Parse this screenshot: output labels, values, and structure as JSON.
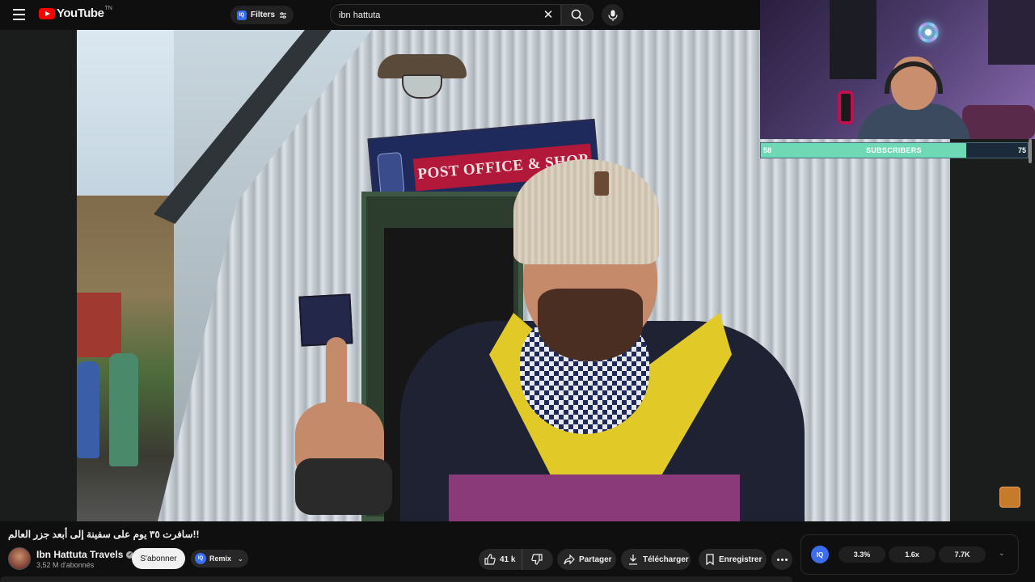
{
  "header": {
    "logo_text": "YouTube",
    "logo_region": "TN",
    "filters_label": "Filters",
    "filters_badge": "IQ",
    "search_value": "ibn hattuta"
  },
  "video_overlay": {
    "sign_text": "POST OFFICE & SHOP"
  },
  "subscriber_goal": {
    "start": "58",
    "label": "SUBSCRIBERS",
    "end": "75",
    "progress_fraction": 0.77,
    "fill_color": "#6fd8b4"
  },
  "video": {
    "title": "!!سافرت ٣٥ يوم على سفينة إلى أبعد جزر العالم",
    "channel_name": "Ibn Hattuta Travels",
    "subscribers": "3,52 M d'abonnés",
    "subscribe_label": "S'abonner",
    "remix_label": "Remix",
    "remix_badge": "IQ"
  },
  "actions": {
    "like_count": "41 k",
    "share_label": "Partager",
    "download_label": "Télécharger",
    "save_label": "Enregistrer"
  },
  "stats": {
    "badge": "IQ",
    "values": [
      "3.3%",
      "1.6x",
      "7.7K"
    ]
  },
  "colors": {
    "accent": "#ff0000",
    "iq_blue": "#3b6df0",
    "background": "#0f0f0f"
  },
  "icons": [
    "menu-icon",
    "youtube-logo-icon",
    "filter-icon",
    "close-icon",
    "search-icon",
    "mic-icon",
    "verified-icon",
    "like-icon",
    "dislike-icon",
    "share-icon",
    "download-icon",
    "bookmark-icon",
    "more-icon",
    "chevron-down-icon"
  ]
}
